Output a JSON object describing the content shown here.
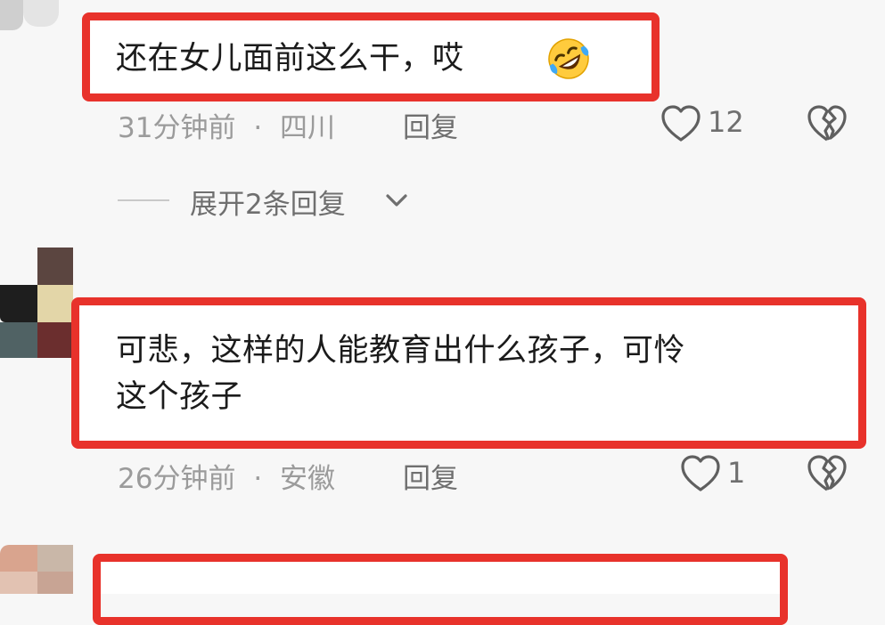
{
  "comments": [
    {
      "text_lines": [
        "还在女儿面前这么干，哎"
      ],
      "emoji": "rolling-on-floor-laughing-emoji",
      "time": "31分钟前",
      "separator": "·",
      "location": "四川",
      "reply_label": "回复",
      "likes": "12",
      "expand_label": "展开2条回复"
    },
    {
      "text_lines": [
        "可悲，这样的人能教育出什么孩子，可怜",
        "这个孩子"
      ],
      "time": "26分钟前",
      "separator": "·",
      "location": "安徽",
      "reply_label": "回复",
      "likes": "1"
    }
  ],
  "colors": {
    "highlight": "#e8322b",
    "meta_text": "#9b9b9b",
    "action_text": "#6f6f6f",
    "background": "#f7f7f7"
  },
  "icons": [
    "heart-outline-icon",
    "broken-heart-icon",
    "chevron-down-icon"
  ]
}
